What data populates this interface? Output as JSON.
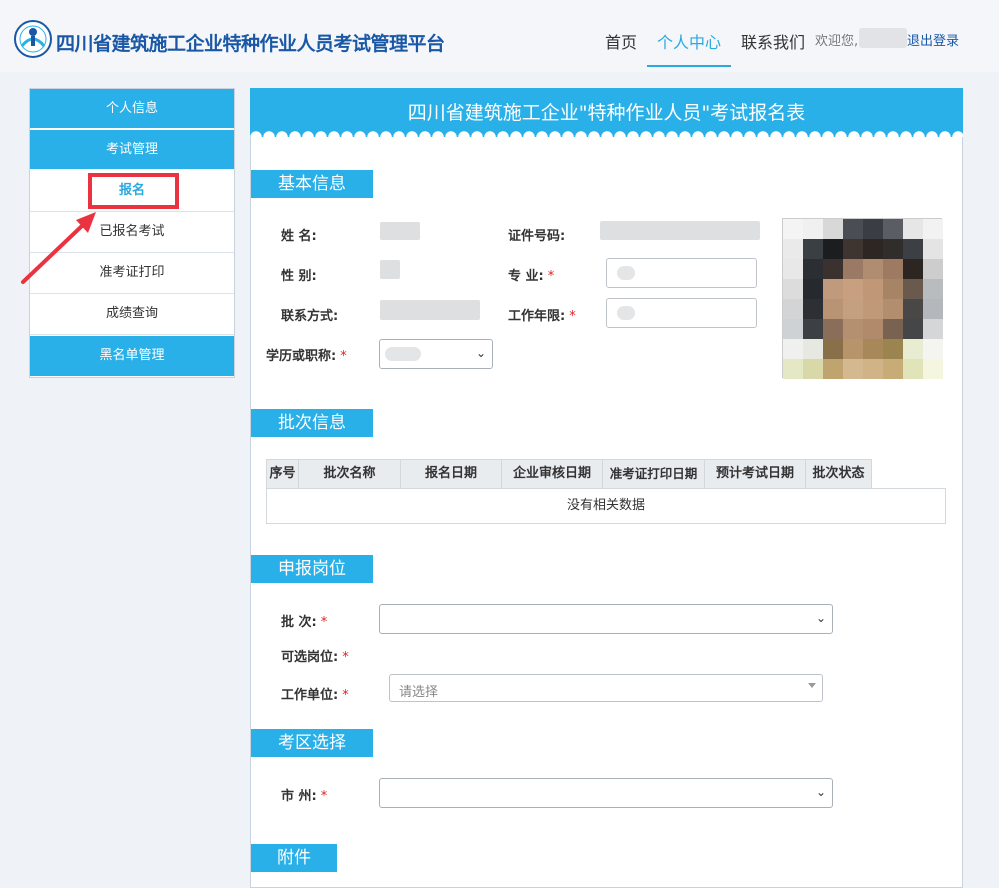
{
  "header": {
    "site_title": "四川省建筑施工企业特种作业人员考试管理平台",
    "nav": [
      "首页",
      "个人中心",
      "联系我们"
    ],
    "active_nav": "个人中心",
    "welcome": "欢迎您,",
    "logout": "退出登录"
  },
  "sidebar": {
    "groups": [
      "个人信息",
      "考试管理",
      "黑名单管理"
    ],
    "items": [
      "报名",
      "已报名考试",
      "准考证打印",
      "成绩查询"
    ],
    "active_item": "报名"
  },
  "form": {
    "title": "四川省建筑施工企业\"特种作业人员\"考试报名表",
    "basic": {
      "section": "基本信息",
      "name_label": "姓    名:",
      "id_label": "证件号码:",
      "gender_label": "性    别:",
      "major_label": "专    业:",
      "contact_label": "联系方式:",
      "years_label": "工作年限:",
      "edu_label": "学历或职称:",
      "required_mark": "*"
    },
    "batch": {
      "section": "批次信息",
      "columns": [
        "序号",
        "批次名称",
        "报名日期",
        "企业审核日期",
        "准考证打印日期",
        "预计考试日期",
        "批次状态"
      ],
      "empty_text": "没有相关数据"
    },
    "post": {
      "section": "申报岗位",
      "batch_label": "批    次:",
      "post_label": "可选岗位:",
      "unit_label": "工作单位:",
      "unit_placeholder": "请选择"
    },
    "region": {
      "section": "考区选择",
      "city_label": "市    州:"
    },
    "attachment": {
      "section": "附件"
    }
  },
  "colors": {
    "accent": "#2ab0e8",
    "title_blue": "#1a58a6",
    "annotation_red": "#ea3340"
  }
}
